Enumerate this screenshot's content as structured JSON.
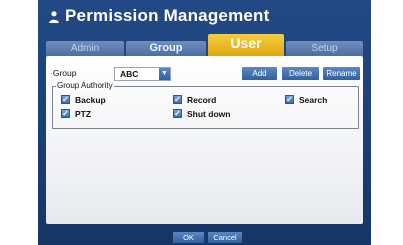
{
  "window": {
    "title": "Permission Management"
  },
  "tabs": [
    {
      "label": "Admin"
    },
    {
      "label": "Group"
    },
    {
      "label": "User"
    },
    {
      "label": "Setup"
    }
  ],
  "group_row": {
    "label": "Group",
    "selected_value": "ABC",
    "buttons": {
      "add": "Add",
      "delete": "Delete",
      "rename": "Rename"
    }
  },
  "authority": {
    "label": "Group Authority",
    "permissions": [
      {
        "label": "Backup",
        "checked": true
      },
      {
        "label": "Record",
        "checked": true
      },
      {
        "label": "Search",
        "checked": true
      },
      {
        "label": "PTZ",
        "checked": true
      },
      {
        "label": "Shut down",
        "checked": true
      }
    ]
  },
  "footer": {
    "ok": "OK",
    "cancel": "Cancel"
  },
  "colors": {
    "dialog_bg": "#1c3f78",
    "active_tab": "#e9b421",
    "button": "#3f6db0"
  }
}
